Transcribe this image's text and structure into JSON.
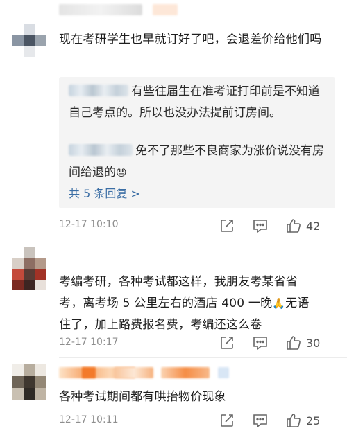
{
  "comments": [
    {
      "text": "现在考研学生也早就订好了吧，会退差价给他们吗",
      "replies": [
        {
          "text": "有些往届生在准考证打印前是不知道自己考点的。所以也没办法提前订房间。"
        },
        {
          "text": "免不了那些不良商家为涨价说没有房间给退的",
          "emoji": "😓"
        }
      ],
      "more_replies": "共 5 条回复 >",
      "time": "12-17 10:10",
      "likes": "42"
    },
    {
      "text_line1": "考编考研，各种考试都这样，我朋友考某省省",
      "text_line2": "考，离考场 5 公里左右的酒店 400 一晚",
      "emoji": "🙏",
      "text_line2b": "无语",
      "text_line3": "住了，加上路费报名费，考编还这么卷",
      "time": "12-17 10:17",
      "likes": "30"
    },
    {
      "text": "各种考试期间都有哄抬物价现象",
      "time": "12-17 10:11",
      "likes": "25"
    }
  ],
  "icons": {
    "share": "share-icon",
    "comment": "comment-icon",
    "like": "thumbs-up-icon"
  },
  "colors": {
    "link": "#3b6ea5",
    "meta": "#8e8e8e",
    "reply_bg": "#f4f4f4"
  }
}
